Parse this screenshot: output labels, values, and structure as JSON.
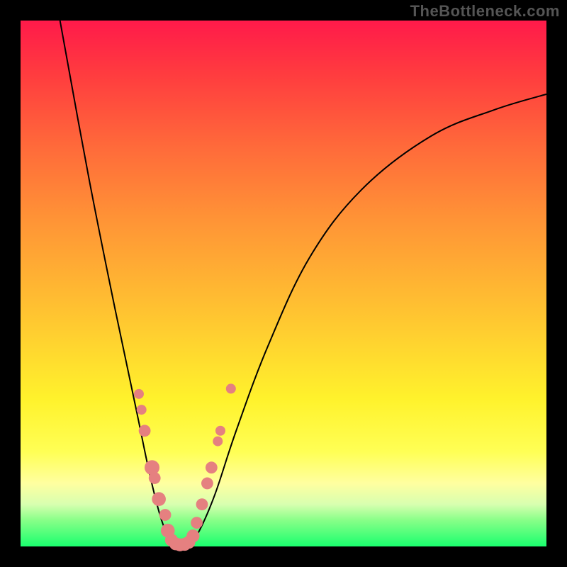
{
  "watermark": "TheBottleneck.com",
  "chart_data": {
    "type": "line",
    "title": "",
    "xlabel": "",
    "ylabel": "",
    "xlim": [
      0,
      100
    ],
    "ylim": [
      0,
      100
    ],
    "gradient_stops": [
      {
        "pos": 0,
        "color": "#ff1a4a"
      },
      {
        "pos": 10,
        "color": "#ff3b3f"
      },
      {
        "pos": 24,
        "color": "#ff6a3a"
      },
      {
        "pos": 38,
        "color": "#ff9436"
      },
      {
        "pos": 55,
        "color": "#ffc231"
      },
      {
        "pos": 72,
        "color": "#fff22c"
      },
      {
        "pos": 82,
        "color": "#ffff55"
      },
      {
        "pos": 88,
        "color": "#ffffa0"
      },
      {
        "pos": 92,
        "color": "#d8ffb0"
      },
      {
        "pos": 95,
        "color": "#88ff88"
      },
      {
        "pos": 100,
        "color": "#1aff6e"
      }
    ],
    "series": [
      {
        "name": "bottleneck-curve",
        "segments": [
          {
            "name": "left-branch",
            "points": [
              {
                "x": 7.5,
                "y": 100
              },
              {
                "x": 13.0,
                "y": 70
              },
              {
                "x": 18.0,
                "y": 45
              },
              {
                "x": 22.0,
                "y": 26
              },
              {
                "x": 24.5,
                "y": 14
              },
              {
                "x": 26.5,
                "y": 6
              },
              {
                "x": 28.0,
                "y": 2
              },
              {
                "x": 29.0,
                "y": 0.3
              }
            ]
          },
          {
            "name": "valley",
            "points": [
              {
                "x": 29.0,
                "y": 0.3
              },
              {
                "x": 30.0,
                "y": 0.1
              },
              {
                "x": 31.0,
                "y": 0.1
              },
              {
                "x": 32.0,
                "y": 0.3
              }
            ]
          },
          {
            "name": "right-branch",
            "points": [
              {
                "x": 32.0,
                "y": 0.3
              },
              {
                "x": 34.0,
                "y": 3
              },
              {
                "x": 37.0,
                "y": 10
              },
              {
                "x": 41.0,
                "y": 22
              },
              {
                "x": 47.0,
                "y": 38
              },
              {
                "x": 55.0,
                "y": 55
              },
              {
                "x": 65.0,
                "y": 68
              },
              {
                "x": 78.0,
                "y": 78
              },
              {
                "x": 90.0,
                "y": 83
              },
              {
                "x": 100.0,
                "y": 86
              }
            ]
          }
        ]
      }
    ],
    "markers": [
      {
        "x": 22.5,
        "y": 29,
        "r": 1.0
      },
      {
        "x": 23.0,
        "y": 26,
        "r": 1.0
      },
      {
        "x": 23.6,
        "y": 22,
        "r": 1.2
      },
      {
        "x": 25.0,
        "y": 15,
        "r": 1.5
      },
      {
        "x": 25.5,
        "y": 13,
        "r": 1.2
      },
      {
        "x": 26.3,
        "y": 9,
        "r": 1.4
      },
      {
        "x": 27.5,
        "y": 6,
        "r": 1.2
      },
      {
        "x": 28.0,
        "y": 3,
        "r": 1.4
      },
      {
        "x": 28.7,
        "y": 1.2,
        "r": 1.3
      },
      {
        "x": 29.5,
        "y": 0.5,
        "r": 1.3
      },
      {
        "x": 30.3,
        "y": 0.3,
        "r": 1.3
      },
      {
        "x": 31.2,
        "y": 0.4,
        "r": 1.3
      },
      {
        "x": 32.0,
        "y": 0.8,
        "r": 1.3
      },
      {
        "x": 32.8,
        "y": 2.0,
        "r": 1.3
      },
      {
        "x": 33.5,
        "y": 4.5,
        "r": 1.2
      },
      {
        "x": 34.5,
        "y": 8.0,
        "r": 1.2
      },
      {
        "x": 35.5,
        "y": 12.0,
        "r": 1.2
      },
      {
        "x": 36.3,
        "y": 15.0,
        "r": 1.2
      },
      {
        "x": 37.5,
        "y": 20.0,
        "r": 1.0
      },
      {
        "x": 38.0,
        "y": 22.0,
        "r": 1.0
      },
      {
        "x": 40.0,
        "y": 30.0,
        "r": 1.0
      }
    ]
  }
}
